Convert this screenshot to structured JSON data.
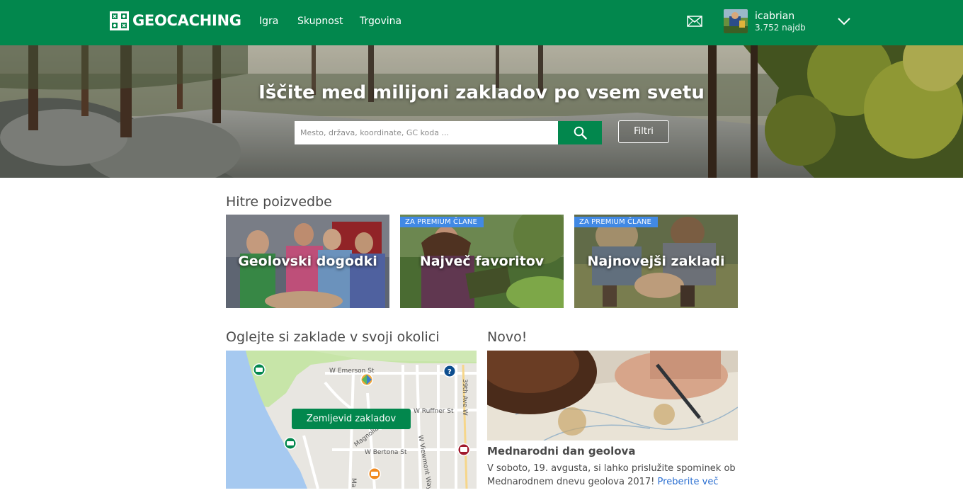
{
  "header": {
    "logo_text": "GEOCACHING",
    "nav": [
      "Igra",
      "Skupnost",
      "Trgovina"
    ],
    "user": {
      "name": "icabrian",
      "finds": "3.752 najdb"
    },
    "icons": [
      "logo-icon",
      "mail-icon",
      "chevron-down-icon"
    ],
    "colors": {
      "brand_green": "#02874d"
    }
  },
  "hero": {
    "title": "Iščite med milijoni zakladov po vsem svetu",
    "search_placeholder": "Mesto, država, koordinate, GC koda ...",
    "filter_label": "Filtri"
  },
  "quick": {
    "title": "Hitre poizvedbe",
    "tiles": [
      {
        "label": "Geolovski dogodki",
        "badge": ""
      },
      {
        "label": "Največ favoritov",
        "badge": "ZA PREMIUM ČLANE"
      },
      {
        "label": "Najnovejši zakladi",
        "badge": "ZA PREMIUM ČLANE"
      }
    ],
    "colors": {
      "premium_badge": "#4189e4"
    }
  },
  "nearby": {
    "title": "Oglejte si zaklade v svoji okolici",
    "map_button": "Zemljevid zakladov",
    "streets": [
      "W Emerson St",
      "W Ruffner St",
      "W Bertona St",
      "Magnolia Blvd",
      "39th Ave W",
      "W Viewmont Way",
      "Ma"
    ]
  },
  "news": {
    "title": "Novo!",
    "headline": "Mednarodni dan geolova",
    "body": "V soboto, 19. avgusta, si lahko prislužite spominek ob Mednarodnem dnevu geolova 2017!",
    "link": "Preberite več",
    "colors": {
      "link": "#2b6fd1"
    }
  }
}
